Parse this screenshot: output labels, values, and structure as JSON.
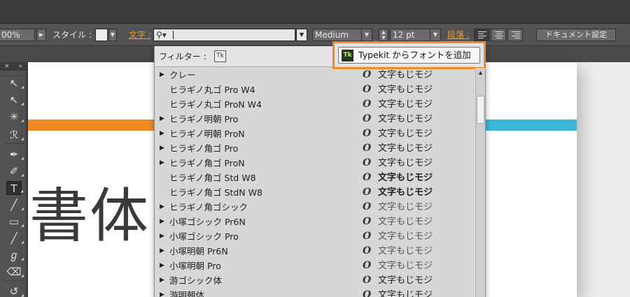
{
  "control_bar": {
    "opacity_value": "00%",
    "style_label": "スタイル :",
    "character_label": "文字 :",
    "font_search_value": "",
    "font_style_value": "Medium",
    "font_size_value": "12 pt",
    "paragraph_label": "段落 :",
    "document_setup_label": "ドキュメント設定"
  },
  "font_menu": {
    "filter_label": "フィルター :",
    "typekit_filter_icon": "Tk",
    "typekit_button_icon": "Tk",
    "typekit_button_label": "Typekit からフォントを追加",
    "fonts": [
      {
        "name": "クレー",
        "expandable": true,
        "sample": "文字もじモジ",
        "weight": "normal"
      },
      {
        "name": "ヒラギノ丸ゴ Pro W4",
        "expandable": false,
        "sample": "文字もじモジ",
        "weight": "normal"
      },
      {
        "name": "ヒラギノ丸ゴ ProN W4",
        "expandable": false,
        "sample": "文字もじモジ",
        "weight": "normal"
      },
      {
        "name": "ヒラギノ明朝 Pro",
        "expandable": true,
        "sample": "文字もじモジ",
        "weight": "normal"
      },
      {
        "name": "ヒラギノ明朝 ProN",
        "expandable": true,
        "sample": "文字もじモジ",
        "weight": "normal"
      },
      {
        "name": "ヒラギノ角ゴ Pro",
        "expandable": true,
        "sample": "文字もじモジ",
        "weight": "normal"
      },
      {
        "name": "ヒラギノ角ゴ ProN",
        "expandable": true,
        "sample": "文字もじモジ",
        "weight": "normal"
      },
      {
        "name": "ヒラギノ角ゴ Std W8",
        "expandable": false,
        "sample": "文字もじモジ",
        "weight": "bold"
      },
      {
        "name": "ヒラギノ角ゴ StdN W8",
        "expandable": false,
        "sample": "文字もじモジ",
        "weight": "bold"
      },
      {
        "name": "ヒラギノ角ゴシック",
        "expandable": true,
        "sample": "文字もじモジ",
        "weight": "light"
      },
      {
        "name": "小塚ゴシック Pr6N",
        "expandable": true,
        "sample": "文字もじモジ",
        "weight": "light"
      },
      {
        "name": "小塚ゴシック Pro",
        "expandable": true,
        "sample": "文字もじモジ",
        "weight": "light"
      },
      {
        "name": "小塚明朝 Pr6N",
        "expandable": true,
        "sample": "文字もじモジ",
        "weight": "light"
      },
      {
        "name": "小塚明朝 Pro",
        "expandable": true,
        "sample": "文字もじモジ",
        "weight": "light"
      },
      {
        "name": "游ゴシック体",
        "expandable": true,
        "sample": "文字もじモジ",
        "weight": "normal"
      },
      {
        "name": "游明朝体",
        "expandable": true,
        "sample": "文字もじモジ",
        "weight": "normal"
      }
    ],
    "opentype_glyph": "O"
  },
  "tools_panel": {
    "header_left": "×",
    "header_right": "»",
    "tools": [
      {
        "name": "selection-tool-icon",
        "glyph": "↖"
      },
      {
        "name": "direct-selection-tool-icon",
        "glyph": "↖"
      },
      {
        "name": "magic-wand-tool-icon",
        "glyph": "✳"
      },
      {
        "name": "lasso-tool-icon",
        "glyph": "ℛ"
      },
      {
        "name": "pen-tool-icon",
        "glyph": "✒"
      },
      {
        "name": "curvature-tool-icon",
        "glyph": "✐"
      },
      {
        "name": "type-tool-icon",
        "glyph": "T"
      },
      {
        "name": "line-tool-icon",
        "glyph": "╱"
      },
      {
        "name": "rectangle-tool-icon",
        "glyph": "▭"
      },
      {
        "name": "paintbrush-tool-icon",
        "glyph": "╱"
      },
      {
        "name": "blob-brush-tool-icon",
        "glyph": "ℊ"
      },
      {
        "name": "eraser-tool-icon",
        "glyph": "⌫"
      },
      {
        "name": "rotate-tool-icon",
        "glyph": "↺"
      }
    ]
  },
  "artboard": {
    "sample_text": "書体",
    "colors": {
      "orange_stripe": "#ef8a25",
      "blue_stripe": "#3fb7d9"
    }
  },
  "colors": {
    "highlight": "#ef8a25",
    "label_orange": "#f09a2a"
  }
}
